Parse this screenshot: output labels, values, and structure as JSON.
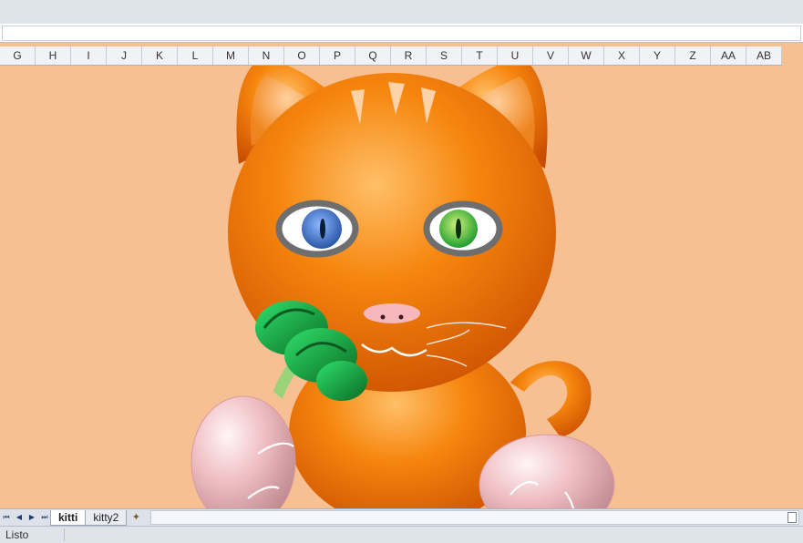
{
  "columns": [
    "G",
    "H",
    "I",
    "J",
    "K",
    "L",
    "M",
    "N",
    "O",
    "P",
    "Q",
    "R",
    "S",
    "T",
    "U",
    "V",
    "W",
    "X",
    "Y",
    "Z",
    "AA",
    "AB"
  ],
  "sheet_tabs": [
    {
      "label": "kitti",
      "active": true
    },
    {
      "label": "kitty2",
      "active": false
    }
  ],
  "status": {
    "text": "Listo"
  },
  "colors": {
    "sheet_background": "#f7c092",
    "cat_orange": "#f07a0c",
    "broccoli_green": "#139a3a"
  }
}
